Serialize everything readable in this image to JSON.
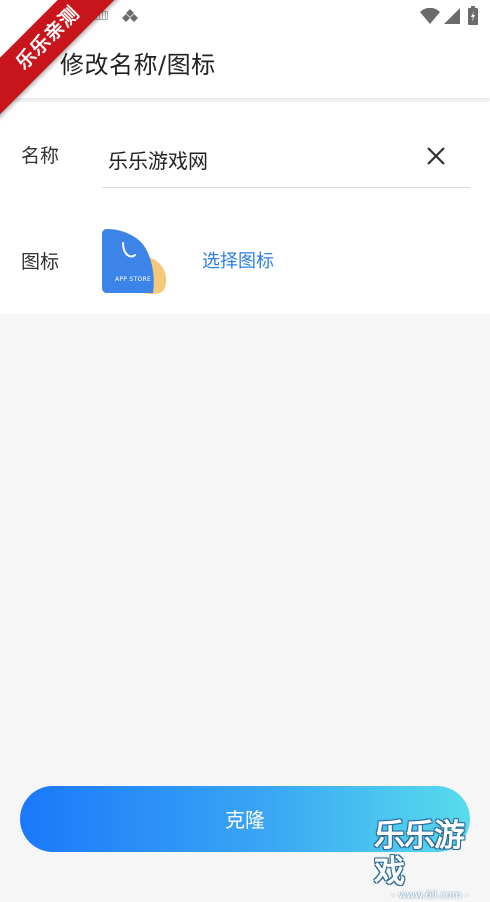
{
  "header": {
    "title": "修改名称/图标"
  },
  "form": {
    "name_label": "名称",
    "name_value": "乐乐游戏网",
    "icon_label": "图标",
    "app_icon_text": "APP STORE",
    "choose_icon_label": "选择图标"
  },
  "actions": {
    "clone_label": "克隆"
  },
  "overlays": {
    "ribbon_text": "乐乐亲测",
    "watermark_text": "乐乐游戏",
    "watermark_url": "- www.6ll.com -"
  },
  "icons": {
    "status": [
      "keyboard-icon",
      "diamond-icon",
      "wifi-icon",
      "signal-icon",
      "battery-icon"
    ],
    "back": "back-arrow-icon",
    "clear": "clear-icon"
  },
  "colors": {
    "accent": "#2d7ee6",
    "button_gradient_start": "#1a78fb",
    "button_gradient_end": "#58dcec",
    "ribbon": "#c8151c",
    "icon_blue": "#3d84e8",
    "icon_yellow": "#f5c97a"
  }
}
